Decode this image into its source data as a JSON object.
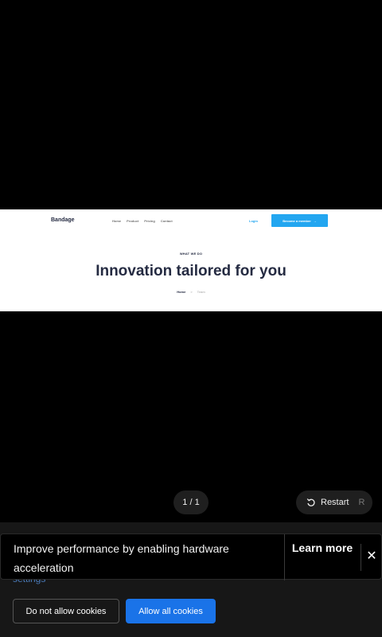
{
  "slide": {
    "brand": "Bandage",
    "menu": [
      "Home",
      "Product",
      "Pricing",
      "Contact"
    ],
    "login": "Login",
    "cta_label": "Become a member",
    "cta_arrow": "→",
    "eyebrow": "WHAT WE DO",
    "hero": "Innovation tailored for you",
    "breadcrumb": {
      "home": "Home",
      "sep": ">",
      "current": "Team"
    }
  },
  "viewer": {
    "counter": "1 / 1",
    "restart_label": "Restart",
    "restart_key": "R"
  },
  "notice": {
    "message": "Improve performance by enabling hardware acceleration",
    "learn_more": "Learn more",
    "close": "✕"
  },
  "cookies": {
    "settings_link": "settings",
    "deny_label": "Do not allow cookies",
    "allow_label": "Allow all cookies"
  },
  "colors": {
    "accent": "#23a6f0",
    "allow_button": "#1a73e8"
  }
}
